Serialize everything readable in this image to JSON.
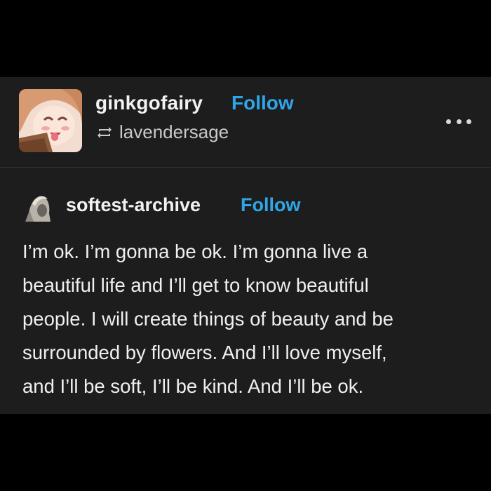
{
  "post": {
    "author": "ginkgofairy",
    "follow_label": "Follow",
    "reblogged_from": "lavendersage",
    "more_icon": "ellipsis-icon",
    "reblog_icon": "reblog-icon"
  },
  "source": {
    "author": "softest-archive",
    "follow_label": "Follow",
    "lines": [
      "I’m ok. I’m gonna be ok. I’m gonna live a",
      "beautiful life and I’ll get to know beautiful",
      "people. I will create things of beauty and be",
      "surrounded by flowers. And I’ll love myself,",
      "and I’ll be soft, I’ll be kind. And I’ll be ok."
    ]
  },
  "colors": {
    "background": "#000000",
    "card": "#1d1d1e",
    "link": "#2fa6e8",
    "text": "#f0f0f0",
    "muted": "#c9c9c9"
  }
}
